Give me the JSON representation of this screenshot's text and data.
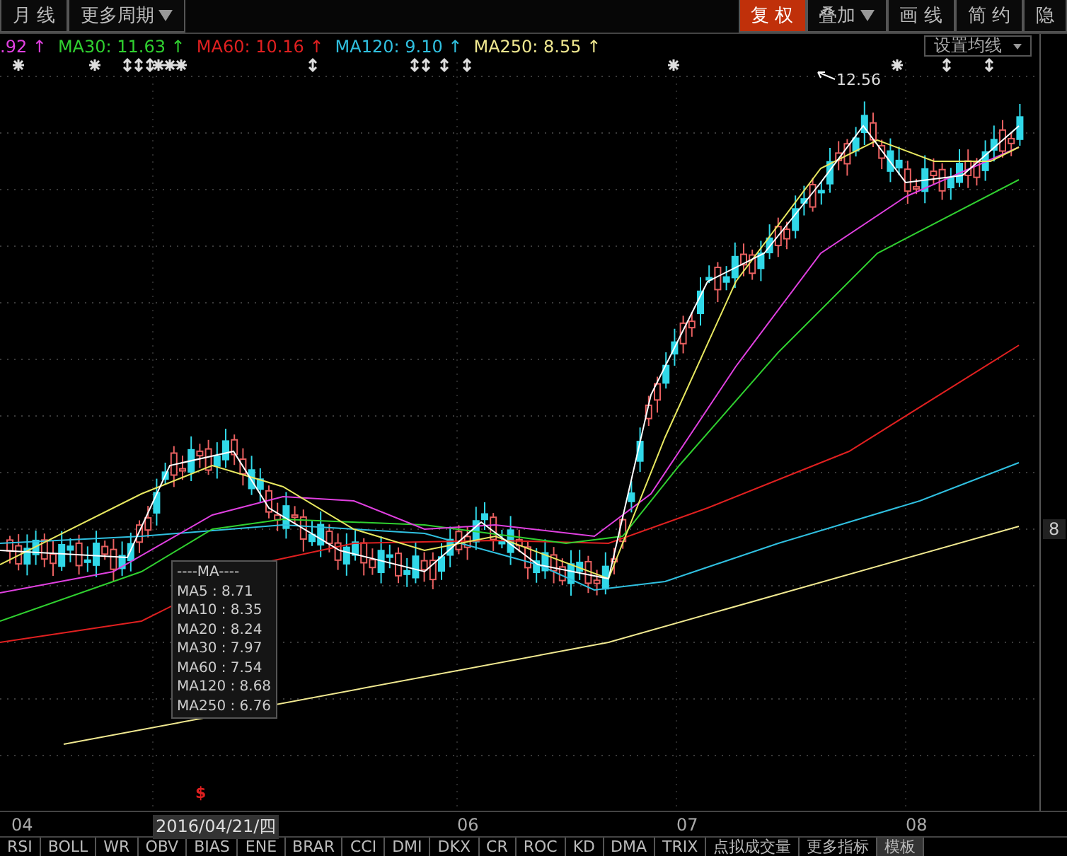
{
  "toolbar": {
    "left": [
      {
        "label": "月 线",
        "dropdown": false
      },
      {
        "label": "更多周期",
        "dropdown": true
      }
    ],
    "right": [
      {
        "label": "复 权",
        "selected": true,
        "dropdown": false
      },
      {
        "label": "叠加",
        "selected": false,
        "dropdown": true
      },
      {
        "label": "画 线",
        "selected": false,
        "dropdown": false
      },
      {
        "label": "简 约",
        "selected": false,
        "dropdown": false
      },
      {
        "label": "隐",
        "selected": false,
        "dropdown": false
      }
    ]
  },
  "ma_legend": [
    {
      "text": ".92",
      "arrow": "↑",
      "color": "#e040e0"
    },
    {
      "text": "MA30: 11.63",
      "arrow": "↑",
      "color": "#30d030"
    },
    {
      "text": "MA60: 10.16",
      "arrow": "↑",
      "color": "#e02020"
    },
    {
      "text": "MA120: 9.10",
      "arrow": "↑",
      "color": "#30c0e0"
    },
    {
      "text": "MA250: 8.55",
      "arrow": "↑",
      "color": "#f0e890"
    }
  ],
  "ma_settings_button": {
    "label": "设置均线",
    "dropdown": true
  },
  "price_label": "12.56",
  "axis_label": "8",
  "tooltip": {
    "title": "----MA----",
    "lines": [
      "MA5 : 8.71",
      "MA10 : 8.35",
      "MA20 : 8.24",
      "MA30 : 7.97",
      "MA60 : 7.54",
      "MA120 : 8.68",
      "MA250 : 6.76"
    ]
  },
  "signal_mark": "$",
  "x_axis": [
    {
      "label": "04",
      "selected": false
    },
    {
      "label": "2016/04/21/四",
      "selected": true
    },
    {
      "label": "06",
      "selected": false
    },
    {
      "label": "07",
      "selected": false
    },
    {
      "label": "08",
      "selected": false
    }
  ],
  "indicator_tabs": [
    {
      "label": "RSI",
      "selected": false
    },
    {
      "label": "BOLL",
      "selected": false
    },
    {
      "label": "WR",
      "selected": false
    },
    {
      "label": "OBV",
      "selected": false
    },
    {
      "label": "BIAS",
      "selected": false
    },
    {
      "label": "ENE",
      "selected": false
    },
    {
      "label": "BRAR",
      "selected": false
    },
    {
      "label": "CCI",
      "selected": false
    },
    {
      "label": "DMI",
      "selected": false
    },
    {
      "label": "DKX",
      "selected": false
    },
    {
      "label": "CR",
      "selected": false
    },
    {
      "label": "ROC",
      "selected": false
    },
    {
      "label": "KD",
      "selected": false
    },
    {
      "label": "DMA",
      "selected": false
    },
    {
      "label": "TRIX",
      "selected": false
    },
    {
      "label": "点拟成交量",
      "selected": false
    },
    {
      "label": "更多指标",
      "selected": false
    },
    {
      "label": "模板",
      "selected": true
    }
  ]
}
